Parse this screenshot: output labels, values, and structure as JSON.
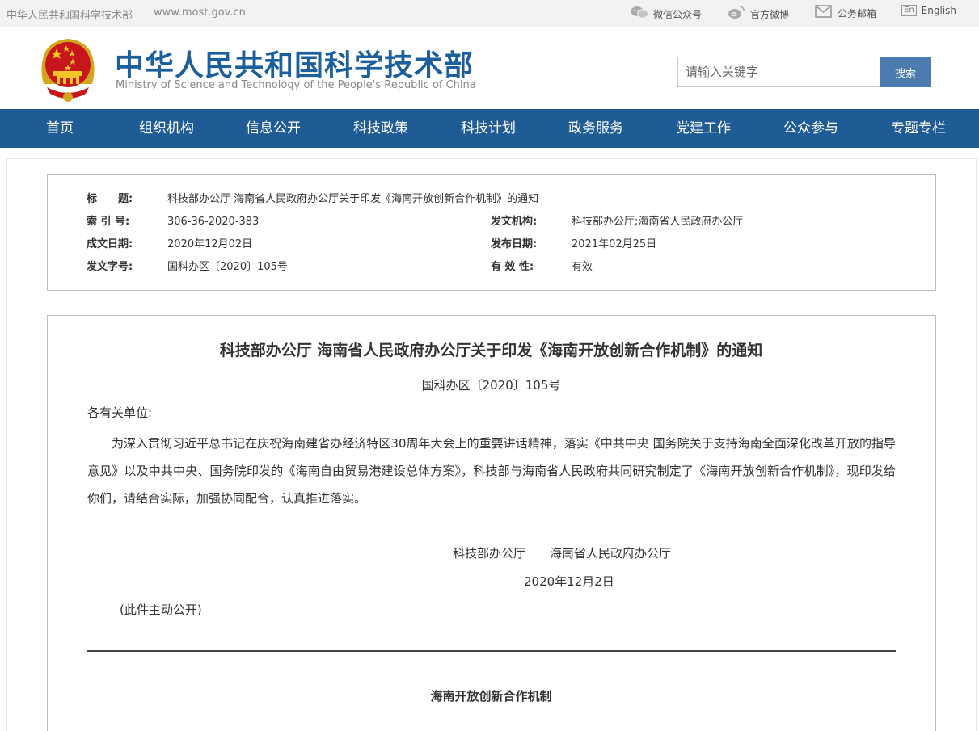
{
  "topbar": {
    "site_name": "中华人民共和国科学技术部",
    "site_url": "www.most.gov.cn",
    "links": [
      {
        "label": "微信公众号",
        "icon": "wechat-icon"
      },
      {
        "label": "官方微博",
        "icon": "weibo-icon"
      },
      {
        "label": "公务邮箱",
        "icon": "mail-icon"
      },
      {
        "label": "English",
        "icon": "english-icon",
        "icon_text": "En"
      }
    ]
  },
  "header": {
    "title_cn": "中华人民共和国科学技术部",
    "title_en": "Ministry of Science and Technology of the People's Republic of China",
    "emblem": "national-emblem-icon"
  },
  "search": {
    "placeholder": "请输入关键字",
    "button_label": "搜索"
  },
  "nav": {
    "items": [
      "首页",
      "组织机构",
      "信息公开",
      "科技政策",
      "科技计划",
      "政务服务",
      "党建工作",
      "公众参与",
      "专题专栏"
    ]
  },
  "meta": {
    "title_label": "标　　题:",
    "title_value": "科技部办公厅 海南省人民政府办公厅关于印发《海南开放创新合作机制》的通知",
    "index_label": "索 引 号:",
    "index_value": "306-36-2020-383",
    "issuer_label": "发文机构:",
    "issuer_value": "科技部办公厅;海南省人民政府办公厅",
    "written_label": "成文日期:",
    "written_value": "2020年12月02日",
    "published_label": "发布日期:",
    "published_value": "2021年02月25日",
    "docno_label": "发文字号:",
    "docno_value": "国科办区〔2020〕105号",
    "validity_label": "有 效 性:",
    "validity_value": "有效"
  },
  "document": {
    "title": "科技部办公厅 海南省人民政府办公厅关于印发《海南开放创新合作机制》的通知",
    "number": "国科办区〔2020〕105号",
    "greeting": "各有关单位:",
    "body": "为深入贯彻习近平总书记在庆祝海南建省办经济特区30周年大会上的重要讲话精神，落实《中共中央 国务院关于支持海南全面深化改革开放的指导意见》以及中共中央、国务院印发的《海南自由贸易港建设总体方案》，科技部与海南省人民政府共同研究制定了《海南开放创新合作机制》，现印发给你们，请结合实际，加强协同配合，认真推进落实。",
    "signatories": "科技部办公厅　　海南省人民政府办公厅",
    "date": "2020年12月2日",
    "note": "(此件主动公开)",
    "attachment_title": "海南开放创新合作机制"
  },
  "colors": {
    "brand_blue": "#1b5f9c",
    "nav_bg": "#1f5b94",
    "search_btn": "#4d7bb0"
  }
}
